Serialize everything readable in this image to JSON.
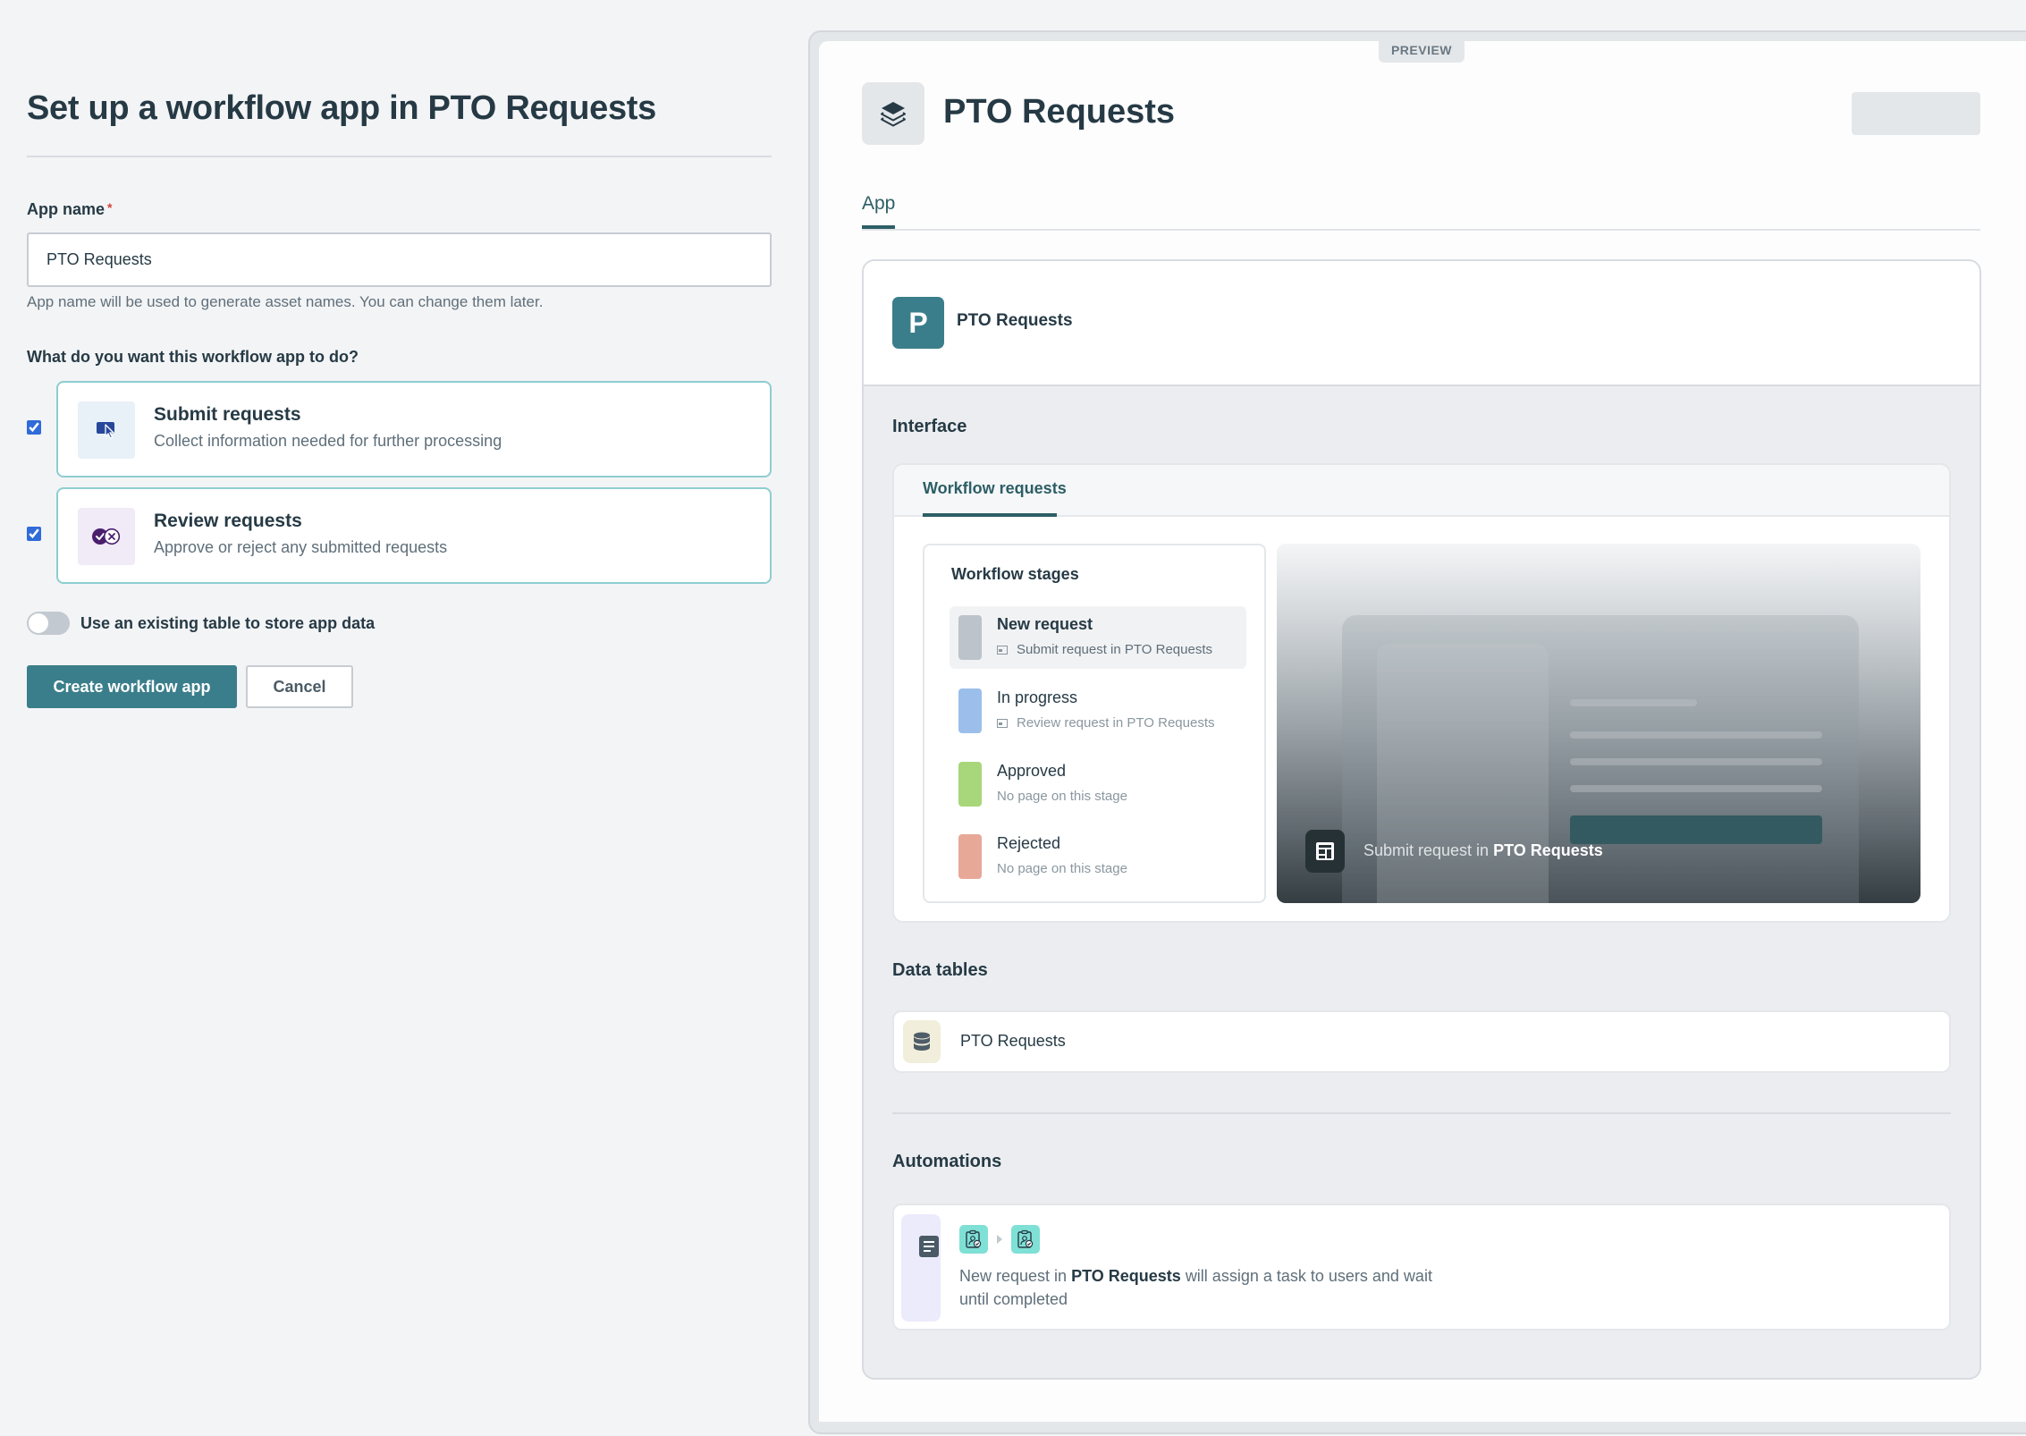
{
  "form": {
    "title": "Set up a workflow app in PTO Requests",
    "app_name_label": "App name",
    "required_marker": "*",
    "app_name_value": "PTO Requests",
    "app_name_hint": "App name will be used to generate asset names. You can change them later.",
    "question": "What do you want this workflow app to do?",
    "options": [
      {
        "title": "Submit requests",
        "description": "Collect information needed for further processing",
        "checked": true,
        "icon": "cursor-click-icon",
        "icon_bg": "#e8f0f8",
        "icon_color": "#27489a"
      },
      {
        "title": "Review requests",
        "description": "Approve or reject any submitted requests",
        "checked": true,
        "icon": "approve-reject-icon",
        "icon_bg": "#f1eaf7",
        "icon_color": "#4a1f6e"
      }
    ],
    "toggle_label": "Use an existing table to store app data",
    "toggle_on": false,
    "create_button": "Create workflow app",
    "cancel_button": "Cancel"
  },
  "preview": {
    "badge": "PREVIEW",
    "app_title": "PTO Requests",
    "tabs": [
      {
        "label": "App",
        "active": true
      }
    ],
    "project": {
      "avatar_letter": "P",
      "name": "PTO Requests"
    },
    "interface": {
      "heading": "Interface",
      "tab": "Workflow requests",
      "stages_title": "Workflow stages",
      "stages": [
        {
          "name": "New request",
          "subtitle": "Submit request in PTO Requests",
          "color": "#bcc3ca",
          "has_page": true,
          "active": true
        },
        {
          "name": "In progress",
          "subtitle": "Review request in PTO Requests",
          "color": "#9bbfea",
          "has_page": true,
          "active": false
        },
        {
          "name": "Approved",
          "subtitle": "No page on this stage",
          "color": "#a8d67a",
          "has_page": false,
          "active": false
        },
        {
          "name": "Rejected",
          "subtitle": "No page on this stage",
          "color": "#e8a898",
          "has_page": false,
          "active": false
        }
      ],
      "page_preview": {
        "caption_prefix": "Submit request in",
        "caption_target": "PTO Requests"
      }
    },
    "data_tables": {
      "heading": "Data tables",
      "items": [
        {
          "name": "PTO Requests"
        }
      ]
    },
    "automations": {
      "heading": "Automations",
      "items": [
        {
          "text_prefix": "New request in",
          "text_target": "PTO Requests",
          "text_suffix": "will assign a task to users and wait until completed"
        }
      ]
    }
  },
  "colors": {
    "accent": "#3b7e8b",
    "tab_active": "#2d5e66",
    "card_border": "#8ecdd0"
  }
}
